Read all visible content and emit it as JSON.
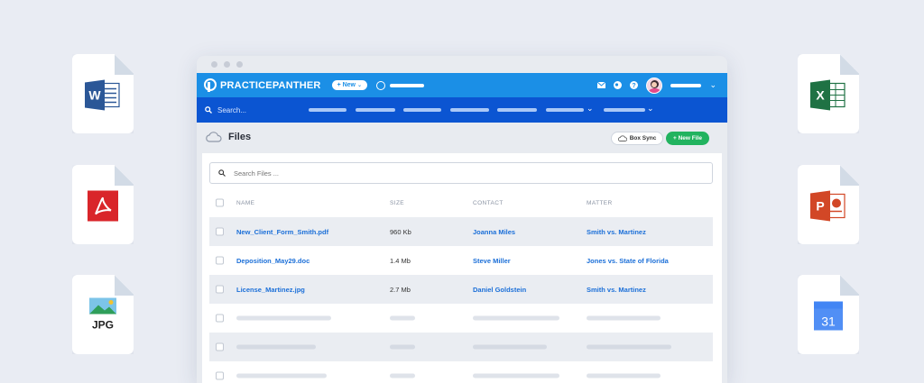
{
  "app": {
    "brand": "PRACTICEPANTHER",
    "new_button": "+ New",
    "search_placeholder": "Search..."
  },
  "page": {
    "title": "Files",
    "box_sync": "Box Sync",
    "new_file": "+ New File",
    "search_files_placeholder": "Search Files ..."
  },
  "table": {
    "headers": [
      "NAME",
      "SIZE",
      "CONTACT",
      "MATTER"
    ],
    "rows": [
      {
        "name": "New_Client_Form_Smith.pdf",
        "size": "960 Kb",
        "contact": "Joanna Miles",
        "matter": "Smith vs. Martinez"
      },
      {
        "name": "Deposition_May29.doc",
        "size": "1.4 Mb",
        "contact": "Steve Miller",
        "matter": "Jones vs. State of Florida"
      },
      {
        "name": "License_Martinez.jpg",
        "size": "2.7 Mb",
        "contact": "Daniel Goldstein",
        "matter": "Smith vs. Martinez"
      }
    ]
  },
  "side_icons": {
    "jpg_label": "JPG",
    "calendar_day": "31",
    "word_letter": "W",
    "excel_letter": "X",
    "powerpoint_letter": "P"
  },
  "colors": {
    "topbar": "#1b8fe6",
    "navbar": "#0b55d2",
    "link": "#1b6fd8",
    "new_file_button": "#22b35f"
  }
}
